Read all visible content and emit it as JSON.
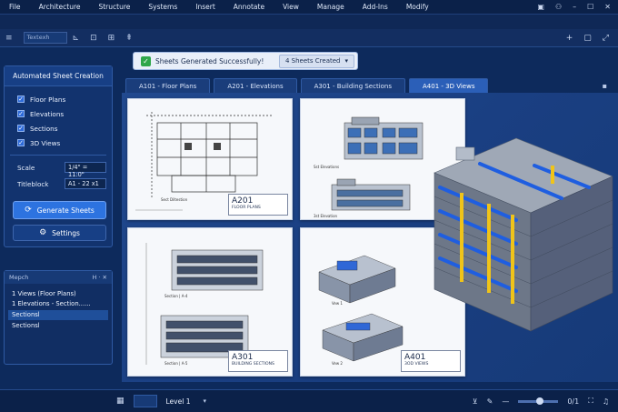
{
  "menu": [
    "File",
    "Architecture",
    "Structure",
    "Systems",
    "Insert",
    "Annotate",
    "View",
    "Manage",
    "Add-Ins",
    "Modify"
  ],
  "toolbar": {
    "type_value": "Textexh"
  },
  "panel": {
    "title": "Automated Sheet Creation",
    "options": [
      {
        "label": "Floor Plans",
        "checked": true
      },
      {
        "label": "Elevations",
        "checked": true
      },
      {
        "label": "Sections",
        "checked": true
      },
      {
        "label": "3D Views",
        "checked": true
      }
    ],
    "scale_label": "Scale",
    "scale_value": "1/4\" = 11:0\"",
    "titleblock_label": "Titleblock",
    "titleblock_value": "A1 - 22 x1",
    "generate_label": "Generate Sheets",
    "settings_label": "Settings"
  },
  "browser": {
    "title": "Mepch",
    "items": [
      "1 Views (Floor Plans)",
      "1 Elevations - Section......",
      "Sectionsl",
      "Sectionsl"
    ]
  },
  "toast": {
    "message": "Sheets Generated Successfully!",
    "count": "4 Sheets Created"
  },
  "tabs": [
    "A101 - Floor Plans",
    "A201 - Elevations",
    "A301 - Building Sections",
    "A401 - 3D Views"
  ],
  "sheets": [
    {
      "number": "A201",
      "title": "FLOOR PLANS",
      "caption": "Sect Diltestion"
    },
    {
      "number": "",
      "title": "",
      "caption": "Sst Elevations",
      "caption2": "3st Elevation"
    },
    {
      "number": "A301",
      "title": "BUILDING SECTIONS",
      "caption": "Section | A-4",
      "caption2": "Section | A-5"
    },
    {
      "number": "A401",
      "title": "3OD VIEWS",
      "caption": "Vew 1",
      "caption2": "Vew 2"
    }
  ],
  "status": {
    "level": "Level 1",
    "zoom": "0/1"
  },
  "colors": {
    "accent": "#2d73e0",
    "background": "#0d2a5c",
    "success": "#2fa64a"
  }
}
